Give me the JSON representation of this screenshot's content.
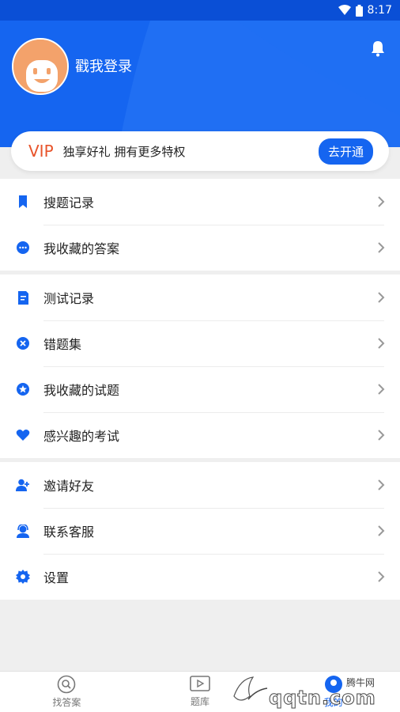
{
  "status_bar": {
    "time": "8:17"
  },
  "header": {
    "login_text": "戳我登录"
  },
  "vip": {
    "label": "VIP",
    "description": "独享好礼 拥有更多特权",
    "button": "去开通"
  },
  "groups": [
    {
      "items": [
        {
          "label": "搜题记录",
          "icon": "bookmark-icon"
        },
        {
          "label": "我收藏的答案",
          "icon": "chat-bubble-icon"
        }
      ]
    },
    {
      "items": [
        {
          "label": "测试记录",
          "icon": "edit-doc-icon"
        },
        {
          "label": "错题集",
          "icon": "close-circle-icon"
        },
        {
          "label": "我收藏的试题",
          "icon": "star-circle-icon"
        },
        {
          "label": "感兴趣的考试",
          "icon": "heart-icon"
        }
      ]
    },
    {
      "items": [
        {
          "label": "邀请好友",
          "icon": "add-user-icon"
        },
        {
          "label": "联系客服",
          "icon": "support-agent-icon"
        },
        {
          "label": "设置",
          "icon": "gear-icon"
        }
      ]
    }
  ],
  "bottom_nav": [
    {
      "label": "找答案",
      "icon": "search-icon"
    },
    {
      "label": "题库",
      "icon": "play-square-icon"
    },
    {
      "label": "我的",
      "icon": "profile-icon"
    }
  ],
  "watermark": {
    "brand": "腾牛网",
    "site": "qqtn.com"
  },
  "colors": {
    "primary": "#1565f0",
    "vip": "#e8542b",
    "avatar": "#f3a26b"
  }
}
